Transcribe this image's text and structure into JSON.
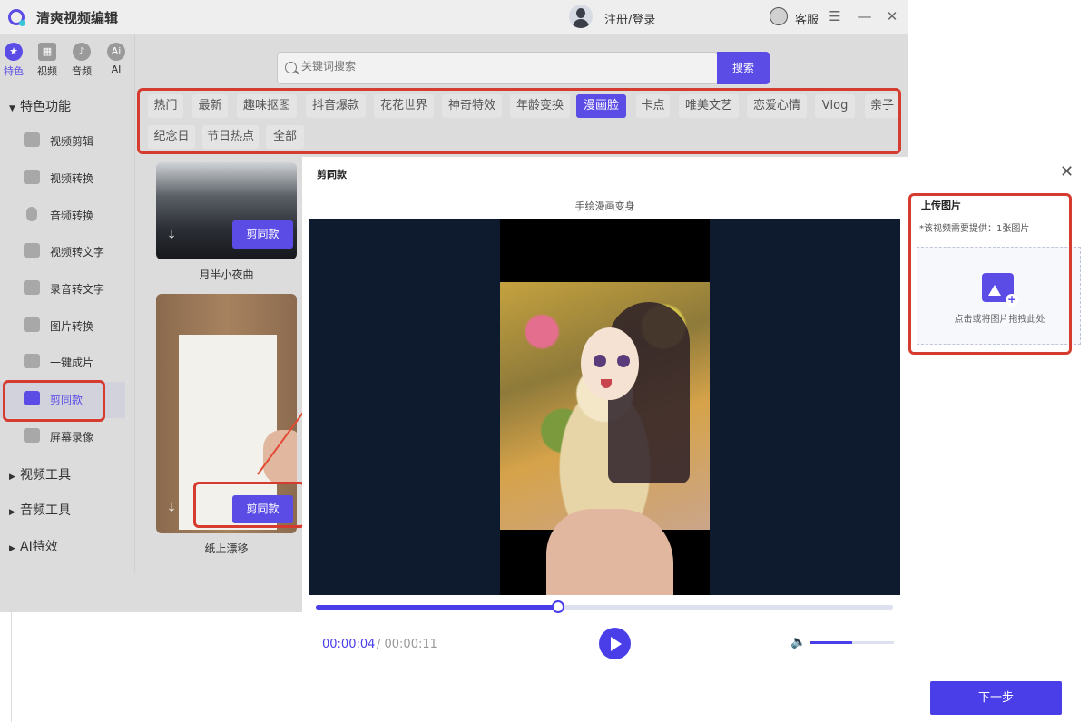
{
  "app": {
    "title": "清爽视频编辑",
    "login_label": "注册/登录",
    "service_label": "客服",
    "window_controls": [
      "menu-icon",
      "minimize-icon",
      "close-icon"
    ]
  },
  "sidebar": {
    "top_nav": [
      {
        "label": "特色",
        "icon": "star-icon",
        "active": true
      },
      {
        "label": "视频",
        "icon": "film-icon",
        "active": false
      },
      {
        "label": "音频",
        "icon": "music-icon",
        "active": false
      },
      {
        "label": "AI",
        "icon": "ai-icon",
        "active": false
      }
    ],
    "section_main": "特色功能",
    "items": [
      {
        "label": "视频剪辑",
        "icon": "video-edit-icon"
      },
      {
        "label": "视频转换",
        "icon": "video-convert-icon"
      },
      {
        "label": "音频转换",
        "icon": "microphone-icon"
      },
      {
        "label": "视频转文字",
        "icon": "video-to-text-icon"
      },
      {
        "label": "录音转文字",
        "icon": "audio-to-text-icon"
      },
      {
        "label": "图片转换",
        "icon": "image-convert-icon"
      },
      {
        "label": "一键成片",
        "icon": "one-click-icon"
      },
      {
        "label": "剪同款",
        "icon": "template-icon",
        "active": true
      },
      {
        "label": "屏幕录像",
        "icon": "screen-record-icon"
      }
    ],
    "sections": [
      "视频工具",
      "音频工具",
      "AI特效"
    ]
  },
  "search": {
    "placeholder": "关键词搜索",
    "button": "搜索"
  },
  "tags": [
    "热门",
    "最新",
    "趣味抠图",
    "抖音爆款",
    "花花世界",
    "神奇特效",
    "年龄变换",
    "漫画脸",
    "卡点",
    "唯美文艺",
    "恋爱心情",
    "Vlog",
    "亲子",
    "纪念日",
    "节日热点",
    "全部"
  ],
  "active_tag": "漫画脸",
  "cards": [
    {
      "title": "月半小夜曲",
      "button": "剪同款"
    },
    {
      "title": "纸上漂移",
      "button": "剪同款"
    }
  ],
  "dialog": {
    "title": "剪同款",
    "video_caption": "手绘漫画变身",
    "current_time": "00:00:04",
    "total_time": "/ 00:00:11",
    "progress": 0.42,
    "volume": 0.5,
    "upload_title": "上传图片",
    "upload_note": "*该视频需要提供：1张图片",
    "dropzone_text": "点击或将图片拖拽此处",
    "next_button": "下一步"
  },
  "colors": {
    "accent": "#5b4ce6",
    "highlight_box": "#d63b2f"
  }
}
